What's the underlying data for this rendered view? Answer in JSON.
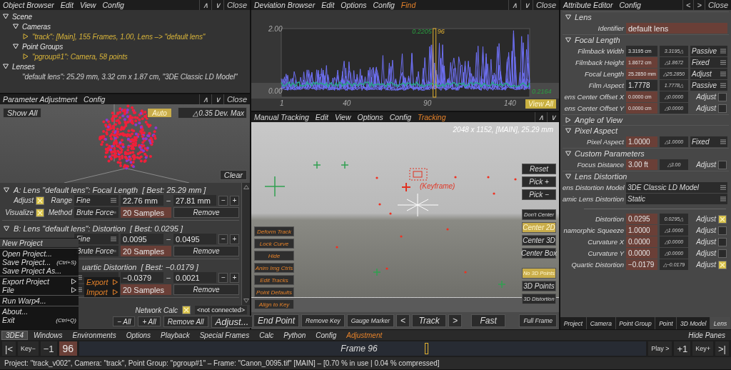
{
  "object_browser": {
    "title": "Object Browser",
    "menu": [
      {
        "label": "Edit",
        "highlighted": false
      },
      {
        "label": "View",
        "highlighted": false
      },
      {
        "label": "Config",
        "highlighted": false
      }
    ],
    "controls": [
      "∧",
      "∨",
      "Close"
    ],
    "tree": [
      {
        "kind": "group",
        "label": "Scene",
        "expanded": true,
        "children": [
          {
            "kind": "group",
            "label": "Cameras",
            "expanded": true,
            "children": [
              {
                "kind": "object",
                "label": "\"track\":  [Main], 155 Frames, 1.00, Lens –> \"default lens\"",
                "expanded": false
              }
            ]
          },
          {
            "kind": "group",
            "label": "Point Groups",
            "expanded": true,
            "children": [
              {
                "kind": "object",
                "label": "\"pgroup#1\":  Camera, 58 points",
                "expanded": false
              }
            ]
          }
        ]
      },
      {
        "kind": "group",
        "label": "Lenses",
        "expanded": true,
        "children": [
          {
            "kind": "leaf",
            "label": "\"default lens\":  25.29 mm, 3.32 cm x 1.87 cm, \"3DE Classic LD Model\""
          }
        ]
      }
    ]
  },
  "parameter_adjustment": {
    "title": "Parameter Adjustment",
    "menu": [
      {
        "label": "Config",
        "highlighted": false
      }
    ],
    "controls": [
      "∧",
      "∨",
      "Close"
    ],
    "show_all": "Show All",
    "auto": {
      "label": "Auto",
      "selected": true
    },
    "dev_max": "△0.35 Dev. Max",
    "clear": "Clear",
    "sections": [
      {
        "title": "A: Lens \"default lens\": Focal Length",
        "best": "[ Best: 25.29 mm ]",
        "expanded": true,
        "adjust_label": "Adjust",
        "adjust": true,
        "visualize_label": "Visualize",
        "visualize": true,
        "range_label": "Range",
        "range": "Fine",
        "method_label": "Method",
        "method": "Brute Force",
        "min": "22.76 mm",
        "to": "–",
        "max": "27.81 mm",
        "minus": "−",
        "plus": "+",
        "samples": "20 Samples",
        "remove": "Remove"
      },
      {
        "title": "B: Lens \"default lens\": Distortion",
        "best": "[ Best: 0.0295 ]",
        "expanded": true,
        "range": "Fine",
        "method": "Brute Force",
        "min": "0.0095",
        "to": "–",
        "max": "0.0495",
        "minus": "−",
        "plus": "+",
        "samples": "20 Samples",
        "remove": "Remove"
      },
      {
        "title": "uartic Distortion",
        "best": "[ Best: −0.0179 ]",
        "min": "−0.0379",
        "to": "–",
        "max": "0.0021",
        "minus": "−",
        "plus": "+",
        "samples": "20 Samples",
        "remove": "Remove"
      }
    ],
    "network_label": "Network Calc",
    "network": true,
    "connection": "<not connected>",
    "minus_all": "− All",
    "plus_all": "+ All",
    "remove_all": "Remove All",
    "adjust": "Adjust..."
  },
  "app_menu": {
    "items": [
      {
        "kind": "item",
        "label": "New Project",
        "selected": true
      },
      {
        "kind": "separator"
      },
      {
        "kind": "item",
        "label": "Open Project...",
        "selected": false
      },
      {
        "kind": "item",
        "label": "Save Project...",
        "shortcut": "(Ctrl+S)",
        "selected": false
      },
      {
        "kind": "item",
        "label": "Save Project As...",
        "selected": false
      },
      {
        "kind": "separator"
      },
      {
        "kind": "item",
        "label": "Export Project",
        "submenu": true,
        "selected": false
      },
      {
        "kind": "item",
        "label": "File",
        "submenu": true,
        "selected": false
      },
      {
        "kind": "separator"
      },
      {
        "kind": "item",
        "label": "Run Warp4...",
        "selected": false
      },
      {
        "kind": "separator"
      },
      {
        "kind": "item",
        "label": "About...",
        "selected": false
      },
      {
        "kind": "item",
        "label": "Exit",
        "shortcut": "(Ctrl+Q)",
        "selected": false
      }
    ],
    "submenu": [
      {
        "label": "Export"
      },
      {
        "label": "Import"
      }
    ]
  },
  "deviation_browser": {
    "title": "Deviation Browser",
    "menu": [
      {
        "label": "Edit",
        "highlighted": false
      },
      {
        "label": "Options",
        "highlighted": false
      },
      {
        "label": "Config",
        "highlighted": false
      },
      {
        "label": "Find",
        "highlighted": true
      }
    ],
    "controls": [
      "∧",
      "∨",
      "Close"
    ],
    "y_labels": [
      "2.00",
      "0.00"
    ],
    "x_labels": [
      "1",
      "40",
      "90",
      "140"
    ],
    "cursor_value": "0.2205",
    "cursor_frame": "96",
    "current_value": "0.2164",
    "view_all": "View All"
  },
  "manual_tracking": {
    "title": "Manual Tracking",
    "menu": [
      {
        "label": "Edit",
        "highlighted": false
      },
      {
        "label": "View",
        "highlighted": false
      },
      {
        "label": "Options",
        "highlighted": false
      },
      {
        "label": "Config",
        "highlighted": false
      },
      {
        "label": "Tracking",
        "highlighted": true
      }
    ],
    "controls": [
      "∧",
      "∨"
    ],
    "info": "2048 x 1152, [MAIN], 25.29 mm",
    "keyframe": "(Keyframe)",
    "left_buttons": [
      "Deform Track",
      "Lock Curve",
      "Hide",
      "Anim Img Ctrls",
      "Edit Tracks",
      "Point Defaults",
      "Align to Key"
    ],
    "right_buttons": [
      {
        "kind": "action",
        "label": "Reset",
        "selected": false
      },
      {
        "kind": "action",
        "label": "Pick +",
        "selected": false
      },
      {
        "kind": "action",
        "label": "Pick −",
        "selected": false
      },
      {
        "kind": "center",
        "label": "Don't Center",
        "selected": false
      },
      {
        "kind": "center",
        "label": "Center 2D",
        "selected": true
      },
      {
        "kind": "center",
        "label": "Center 3D",
        "selected": false
      },
      {
        "kind": "center",
        "label": "Center Box",
        "selected": false
      },
      {
        "kind": "points",
        "label": "No 3D Points",
        "selected": true
      },
      {
        "kind": "points",
        "label": "3D Points",
        "selected": false
      },
      {
        "kind": "points",
        "label": "3D Distortion",
        "selected": false
      }
    ],
    "bottom_buttons": [
      "End Point",
      "Remove Key",
      "Gauge Marker",
      "<",
      "Track",
      ">",
      "Fast",
      "Full Frame"
    ]
  },
  "attribute_editor": {
    "title": "Attribute Editor",
    "menu": [
      {
        "label": "Config",
        "highlighted": false
      }
    ],
    "controls": [
      "<",
      ">",
      "Close"
    ],
    "groups": [
      {
        "title": "Lens",
        "expanded": true,
        "rows": [
          {
            "kind": "text",
            "label": "Identifier",
            "value": "default lens"
          }
        ]
      },
      {
        "title": "Focal Length",
        "expanded": true,
        "rows": [
          {
            "kind": "mode",
            "label": "Filmback Width",
            "value": "3.3195 cm",
            "editable": false,
            "delta": "3.3195△",
            "mode": "Passive"
          },
          {
            "kind": "mode",
            "label": "Filmback Height",
            "value": "1.8672 cm",
            "editable": true,
            "delta": "△1.8672",
            "mode": "Fixed"
          },
          {
            "kind": "mode",
            "label": "Focal Length",
            "value": "25.2850 mm",
            "editable": true,
            "delta": "△25.2850",
            "mode": "Adjust"
          },
          {
            "kind": "mode",
            "label": "Film Aspect",
            "value": "1.7778",
            "editable": false,
            "delta": "1.7778△",
            "mode": "Passive"
          },
          {
            "kind": "check",
            "label": "ens Center Offset X",
            "value": "0.0000 cm",
            "editable": true,
            "delta": "△0.0000",
            "check_label": "Adjust",
            "checked": false
          },
          {
            "kind": "check",
            "label": "ens Center Offset Y",
            "value": "0.0000 cm",
            "editable": true,
            "delta": "△0.0000",
            "check_label": "Adjust",
            "checked": false
          }
        ]
      },
      {
        "title": "Angle of View",
        "expanded": false
      },
      {
        "title": "Pixel Aspect",
        "expanded": true,
        "rows": [
          {
            "kind": "mode",
            "label": "Pixel Aspect",
            "value": "1.0000",
            "editable": true,
            "delta": "△1.0000",
            "mode": "Fixed"
          }
        ]
      },
      {
        "title": "Custom Parameters",
        "expanded": true,
        "rows": [
          {
            "kind": "check",
            "label": "Focus Distance",
            "value": "3.00 ft",
            "editable": true,
            "delta": "△3.00",
            "check_label": "Adjust",
            "checked": false
          }
        ]
      },
      {
        "title": "Lens Distortion",
        "expanded": true,
        "rows": [
          {
            "kind": "select",
            "label": "ens Distortion Model",
            "value": "3DE Classic LD Model"
          },
          {
            "kind": "select",
            "label": "amic Lens Distortion",
            "value": "Static"
          },
          {
            "kind": "divider"
          },
          {
            "kind": "check",
            "label": "Distortion",
            "value": "0.0295",
            "editable": true,
            "delta": "0.0295△",
            "check_label": "Adjust",
            "checked": true
          },
          {
            "kind": "check",
            "label": "namorphic Squeeze",
            "value": "1.0000",
            "editable": true,
            "delta": "△1.0000",
            "check_label": "Adjust",
            "checked": false
          },
          {
            "kind": "check",
            "label": "Curvature X",
            "value": "0.0000",
            "editable": true,
            "delta": "△0.0000",
            "check_label": "Adjust",
            "checked": false
          },
          {
            "kind": "check",
            "label": "Curvature Y",
            "value": "0.0000",
            "editable": true,
            "delta": "△0.0000",
            "check_label": "Adjust",
            "checked": false
          },
          {
            "kind": "check",
            "label": "Quartic Distortion",
            "value": "−0.0179",
            "editable": true,
            "delta": "△−0.0179",
            "check_label": "Adjust",
            "checked": true
          }
        ]
      }
    ],
    "tabs": [
      {
        "label": "Project",
        "selected": false
      },
      {
        "label": "Camera",
        "selected": false
      },
      {
        "label": "Point Group",
        "selected": false
      },
      {
        "label": "Point",
        "selected": false
      },
      {
        "label": "3D Model",
        "selected": false
      },
      {
        "label": "Lens",
        "selected": true
      }
    ]
  },
  "menu_bar": {
    "items": [
      {
        "label": "3DE4",
        "selected": true,
        "highlighted": false
      },
      {
        "label": "Windows",
        "selected": false,
        "highlighted": false
      },
      {
        "label": "Environments",
        "selected": false,
        "highlighted": false
      },
      {
        "label": "Options",
        "selected": false,
        "highlighted": false
      },
      {
        "label": "Playback",
        "selected": false,
        "highlighted": false
      },
      {
        "label": "Special Frames",
        "selected": false,
        "highlighted": false
      },
      {
        "label": "Calc",
        "selected": false,
        "highlighted": false
      },
      {
        "label": "Python",
        "selected": false,
        "highlighted": false
      },
      {
        "label": "Config",
        "selected": false,
        "highlighted": false
      },
      {
        "label": "Adjustment",
        "selected": false,
        "highlighted": true
      }
    ],
    "hide_panes": "Hide Panes"
  },
  "timeline": {
    "first": "|<",
    "key_prev": "Key−",
    "minus": "−1",
    "frame": "96",
    "label": "Frame 96",
    "level": 0.61,
    "play": "Play >",
    "plus": "+1",
    "key_next": "Key+",
    "last": ">|"
  },
  "status_bar": "Project: \"track_v002\", Camera: \"track\", Point Group: \"pgroup#1\"  –  Frame: \"Canon_0095.tif\"  [MAIN]  –  [0.70 % in use | 0.04 % compressed]"
}
